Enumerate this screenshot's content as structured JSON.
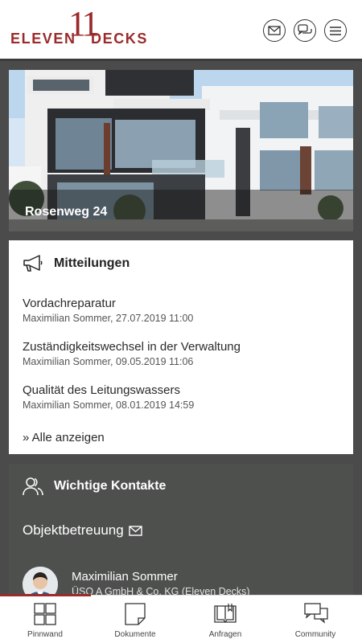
{
  "brand": {
    "word1": "ELEVEN",
    "number": "11",
    "word2": "DECKS"
  },
  "header": {
    "icons": [
      "mail-icon",
      "chat-icon",
      "menu-icon"
    ]
  },
  "hero": {
    "title": "Rosenweg 24"
  },
  "messages": {
    "title": "Mitteilungen",
    "items": [
      {
        "subject": "Vordachreparatur",
        "meta": "Maximilian Sommer, 27.07.2019 11:00"
      },
      {
        "subject": "Zuständigkeitswechsel in der Verwaltung",
        "meta": "Maximilian Sommer, 09.05.2019 11:06"
      },
      {
        "subject": "Qualität des Leitungswassers",
        "meta": "Maximilian Sommer, 08.01.2019 14:59"
      }
    ],
    "show_all": "» Alle anzeigen"
  },
  "contacts": {
    "title": "Wichtige Kontakte",
    "section": "Objektbetreuung",
    "person": {
      "name": "Maximilian Sommer",
      "company": "ÜSO A GmbH & Co. KG (Eleven Decks)"
    }
  },
  "nav": {
    "items": [
      {
        "label": "Pinnwand",
        "icon": "grid-icon"
      },
      {
        "label": "Dokumente",
        "icon": "document-icon"
      },
      {
        "label": "Anfragen",
        "icon": "book-icon"
      },
      {
        "label": "Community",
        "icon": "chat-icon"
      }
    ],
    "active": "Pinnwand"
  },
  "colors": {
    "brand": "#9b2a2a",
    "background": "#4a4b4a"
  }
}
